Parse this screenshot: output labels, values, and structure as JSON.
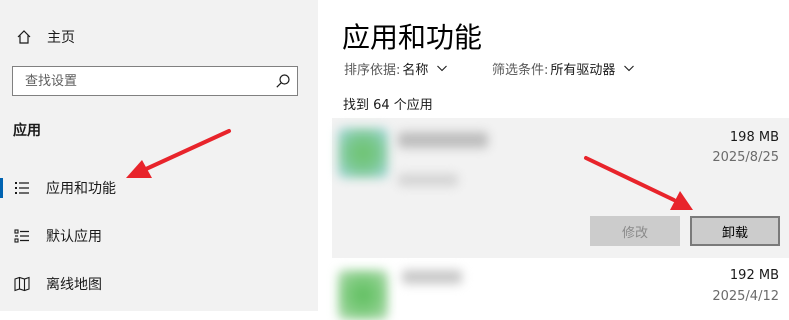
{
  "nav": {
    "home_label": "主页",
    "search_placeholder": "查找设置",
    "section_heading": "应用",
    "items": [
      {
        "label": "应用和功能"
      },
      {
        "label": "默认应用"
      },
      {
        "label": "离线地图"
      }
    ]
  },
  "main": {
    "title": "应用和功能",
    "sort": {
      "label": "排序依据:",
      "value": "名称"
    },
    "filter": {
      "label": "筛选条件:",
      "value": "所有驱动器"
    },
    "found_count": "找到 64 个应用",
    "apps": [
      {
        "size": "198 MB",
        "date": "2025/8/25",
        "modify_label": "修改",
        "uninstall_label": "卸载"
      },
      {
        "size": "192 MB",
        "date": "2025/4/12"
      }
    ]
  },
  "colors": {
    "nav_background": "#f2f2f2",
    "accent": "#0063b1",
    "annotation_arrow": "#e8242b"
  },
  "icons": [
    "home-icon",
    "search-icon",
    "apps-features-icon",
    "default-apps-icon",
    "offline-maps-icon",
    "chevron-down-icon"
  ]
}
